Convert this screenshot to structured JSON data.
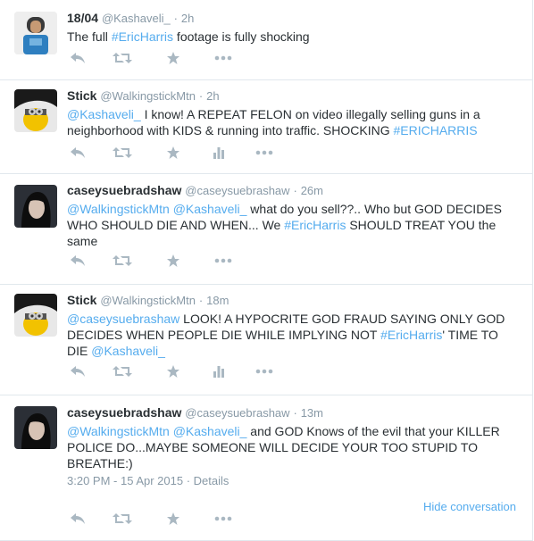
{
  "tweets": [
    {
      "fullname": "18/04",
      "username": "@Kashaveli_",
      "sep": "·",
      "time": "2h",
      "text_parts": [
        "The full ",
        "#EricHarris",
        " footage is fully shocking"
      ],
      "has_stats": false
    },
    {
      "fullname": "Stick",
      "username": "@WalkingstickMtn",
      "sep": "·",
      "time": "2h",
      "text_parts": [
        "@Kashaveli_",
        " I know! A REPEAT FELON on video illegally selling guns in a neighborhood with KIDS & running into traffic. SHOCKING ",
        "#ERICHARRIS"
      ],
      "has_stats": true
    },
    {
      "fullname": "caseysuebradshaw",
      "username": "@caseysuebrashaw",
      "sep": "·",
      "time": "26m",
      "text_parts": [
        "@WalkingstickMtn",
        " ",
        "@Kashaveli_",
        " what do you sell??.. Who but GOD DECIDES WHO SHOULD DIE AND WHEN... We ",
        "#EricHarris",
        " SHOULD TREAT YOU the same"
      ],
      "has_stats": false
    },
    {
      "fullname": "Stick",
      "username": "@WalkingstickMtn",
      "sep": "·",
      "time": "18m",
      "text_parts": [
        "@caseysuebrashaw",
        " LOOK! A HYPOCRITE GOD FRAUD SAYING ONLY GOD DECIDES WHEN PEOPLE DIE WHILE IMPLYING NOT ",
        "#EricHarris",
        "' TIME TO DIE ",
        "@Kashaveli_"
      ],
      "has_stats": true
    },
    {
      "fullname": "caseysuebradshaw",
      "username": "@caseysuebrashaw",
      "sep": "·",
      "time": "13m",
      "text_parts": [
        "@WalkingstickMtn",
        " ",
        "@Kashaveli_",
        " and GOD Knows of the evil that your KILLER POLICE DO...MAYBE SOMEONE WILL DECIDE YOUR TOO STUPID TO BREATHE:)"
      ],
      "has_stats": false,
      "timestamp": "3:20 PM - 15 Apr 2015 · Details",
      "hide_conversation": "Hide conversation"
    }
  ],
  "colors": {
    "link": "#55acee",
    "muted": "#8899a6",
    "icon": "#aab8c2",
    "border": "#e1e8ed"
  },
  "icons": [
    "reply-icon",
    "retweet-icon",
    "favorite-icon",
    "stats-icon",
    "more-icon"
  ]
}
